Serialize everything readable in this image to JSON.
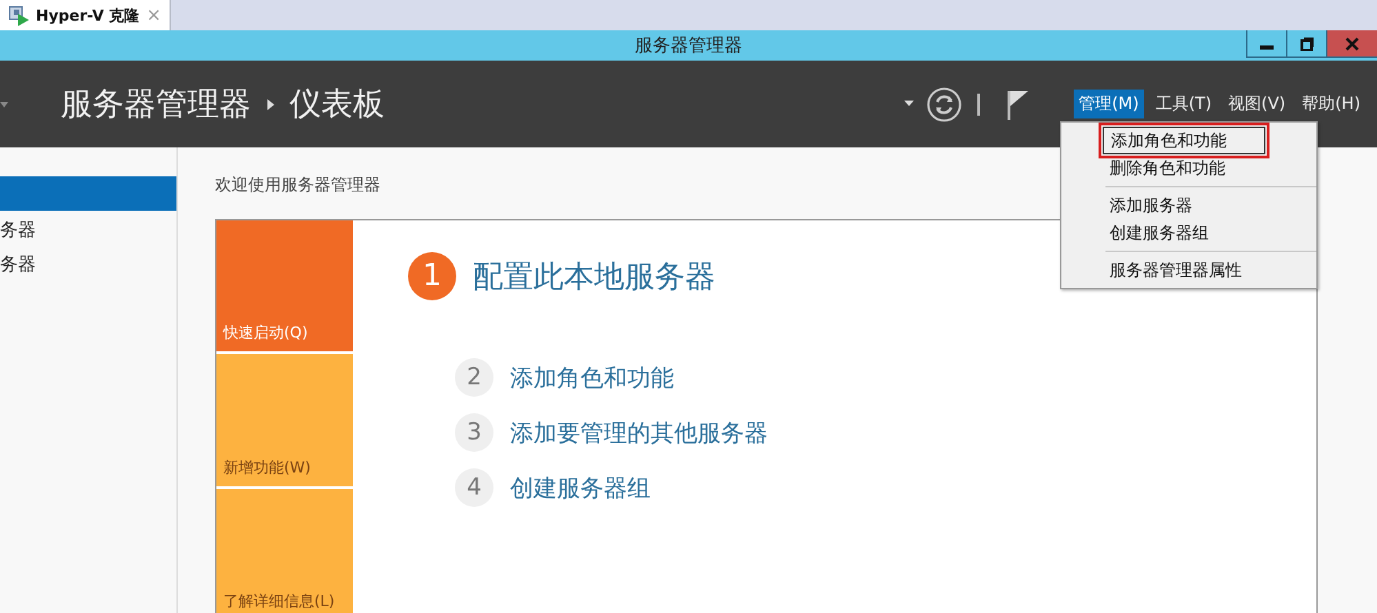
{
  "browser_tab": {
    "title": "Hyper-V 克隆",
    "close": "×"
  },
  "window": {
    "title": "服务器管理器"
  },
  "header": {
    "breadcrumb": [
      "服务器管理器",
      "仪表板"
    ],
    "menus": [
      {
        "label": "管理(M)",
        "selected": true
      },
      {
        "label": "工具(T)",
        "selected": false
      },
      {
        "label": "视图(V)",
        "selected": false
      },
      {
        "label": "帮助(H)",
        "selected": false
      }
    ]
  },
  "menu_dropdown": {
    "groups": [
      [
        {
          "label": "添加角色和功能",
          "selected": true
        },
        {
          "label": "删除角色和功能",
          "selected": false
        }
      ],
      [
        {
          "label": "添加服务器",
          "selected": false
        },
        {
          "label": "创建服务器组",
          "selected": false
        }
      ],
      [
        {
          "label": "服务器管理器属性",
          "selected": false
        }
      ]
    ]
  },
  "sidebar": {
    "items": [
      {
        "selected": true
      },
      {
        "label": "务器",
        "selected": false
      },
      {
        "label": "务器",
        "selected": false
      }
    ]
  },
  "welcome": {
    "title": "欢迎使用服务器管理器",
    "tiles": [
      {
        "label": "快速启动(Q)",
        "selected": true
      },
      {
        "label": "新增功能(W)",
        "selected": false
      },
      {
        "label": "了解详细信息(L)",
        "selected": false
      }
    ],
    "steps": [
      {
        "number": "1",
        "label": "配置此本地服务器",
        "kind": "primary"
      },
      {
        "number": "2",
        "label": "添加角色和功能",
        "kind": "secondary"
      },
      {
        "number": "3",
        "label": "添加要管理的其他服务器",
        "kind": "secondary"
      },
      {
        "number": "4",
        "label": "创建服务器组",
        "kind": "secondary"
      }
    ]
  }
}
